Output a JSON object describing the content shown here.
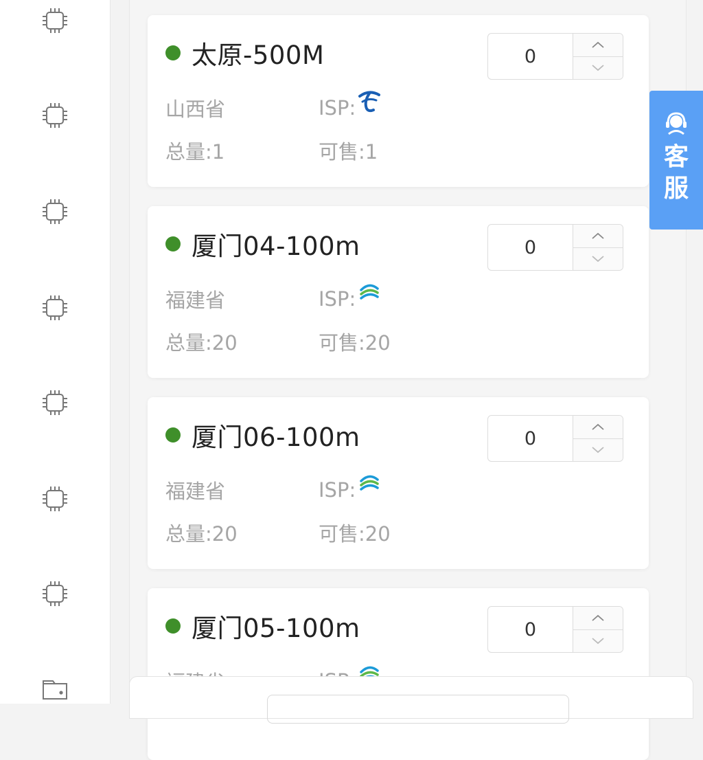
{
  "colors": {
    "online": "#3f8f2a",
    "accent": "#5aa0f5",
    "telecom": "#1a5fb4"
  },
  "sidebar": {
    "icons": [
      "chip-icon",
      "chip-icon",
      "chip-icon",
      "chip-icon",
      "chip-icon",
      "chip-icon",
      "chip-icon",
      "wallet-icon"
    ]
  },
  "cards": [
    {
      "title": "太原-500M",
      "province": "山西省",
      "isp_label": "ISP:",
      "isp_icon": "china-telecom-icon",
      "total": "总量:1",
      "available": "可售:1",
      "quantity": "0"
    },
    {
      "title": "厦门04-100m",
      "province": "福建省",
      "isp_label": "ISP:",
      "isp_icon": "china-mobile-icon",
      "total": "总量:20",
      "available": "可售:20",
      "quantity": "0"
    },
    {
      "title": "厦门06-100m",
      "province": "福建省",
      "isp_label": "ISP:",
      "isp_icon": "china-mobile-icon",
      "total": "总量:20",
      "available": "可售:20",
      "quantity": "0"
    },
    {
      "title": "厦门05-100m",
      "province": "福建省",
      "isp_label": "ISP:",
      "isp_icon": "china-mobile-icon",
      "total": "",
      "available": "",
      "quantity": "0"
    }
  ],
  "customer_service": {
    "line1": "客",
    "line2": "服",
    "icon": "headset-icon"
  }
}
